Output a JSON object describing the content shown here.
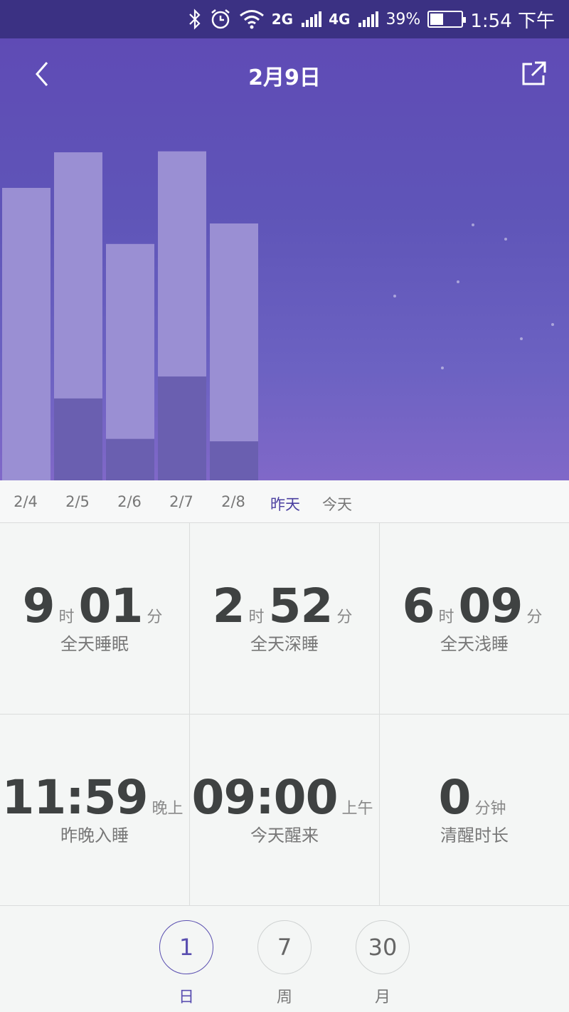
{
  "status_bar": {
    "network_2g": "2G",
    "network_4g": "4G",
    "battery": "39%",
    "time": "1:54 下午"
  },
  "header": {
    "title": "2月9日"
  },
  "chart_data": {
    "type": "bar",
    "categories": [
      "2/4",
      "2/5",
      "2/6",
      "2/7",
      "2/8",
      "昨天"
    ],
    "series": [
      {
        "name": "深睡",
        "values": [
          0,
          1.68,
          0.85,
          2.13,
          0.8,
          null
        ]
      },
      {
        "name": "浅睡",
        "values": [
          6.0,
          5.05,
          4.0,
          4.62,
          4.47,
          null
        ]
      }
    ]
  },
  "axis_labels": [
    "2/4",
    "2/5",
    "2/6",
    "2/7",
    "2/8",
    "昨天",
    "今天"
  ],
  "axis_active_index": 5,
  "stats": [
    {
      "hours": "9",
      "hour_unit": "时",
      "minutes": "01",
      "minute_unit": "分",
      "label": "全天睡眠"
    },
    {
      "hours": "2",
      "hour_unit": "时",
      "minutes": "52",
      "minute_unit": "分",
      "label": "全天深睡"
    },
    {
      "hours": "6",
      "hour_unit": "时",
      "minutes": "09",
      "minute_unit": "分",
      "label": "全天浅睡"
    }
  ],
  "times": [
    {
      "value": "11:59",
      "suffix": "晚上",
      "label": "昨晚入睡"
    },
    {
      "value": "09:00",
      "suffix": "上午",
      "label": "今天醒来"
    },
    {
      "value": "0",
      "suffix": "分钟",
      "label": "清醒时长"
    }
  ],
  "periods": [
    {
      "value": "1",
      "label": "日",
      "active": true
    },
    {
      "value": "7",
      "label": "周",
      "active": false
    },
    {
      "value": "30",
      "label": "月",
      "active": false
    }
  ],
  "colors": {
    "light": "#9a8fd3",
    "light_active": "#b6b1dc",
    "deep": "#6a5fb0",
    "deep_active": "#544b95"
  }
}
